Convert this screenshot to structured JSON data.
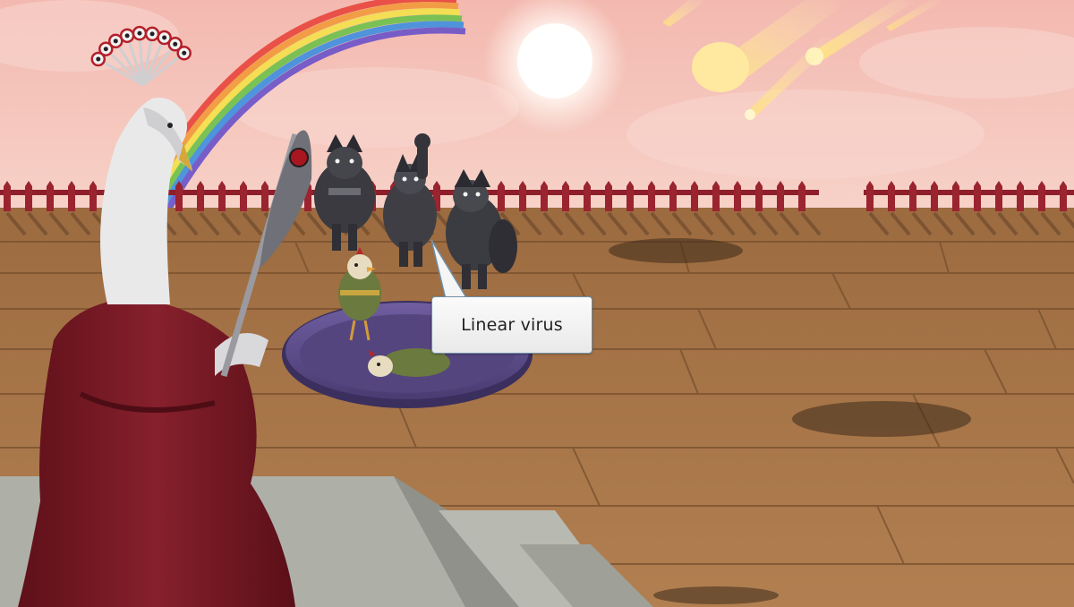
{
  "scene": {
    "dialog": {
      "text": "Linear virus"
    },
    "colors": {
      "sky": "#f4c4bc",
      "deck_wood": "#a8764a",
      "fence": "#8e1f2a",
      "robe": "#7c1a26",
      "pool": "#5b4a86",
      "bubble_border": "#6f8fa6"
    },
    "characters": [
      {
        "name": "peacock-overlord",
        "icon": "peacock-icon"
      },
      {
        "name": "wolf-soldier-left",
        "icon": "wolf-icon"
      },
      {
        "name": "wolf-soldier-middle",
        "icon": "wolf-icon"
      },
      {
        "name": "wolf-soldier-right",
        "icon": "wolf-icon"
      },
      {
        "name": "chicken-standing",
        "icon": "chicken-icon"
      },
      {
        "name": "chicken-fallen",
        "icon": "chicken-icon"
      }
    ]
  }
}
